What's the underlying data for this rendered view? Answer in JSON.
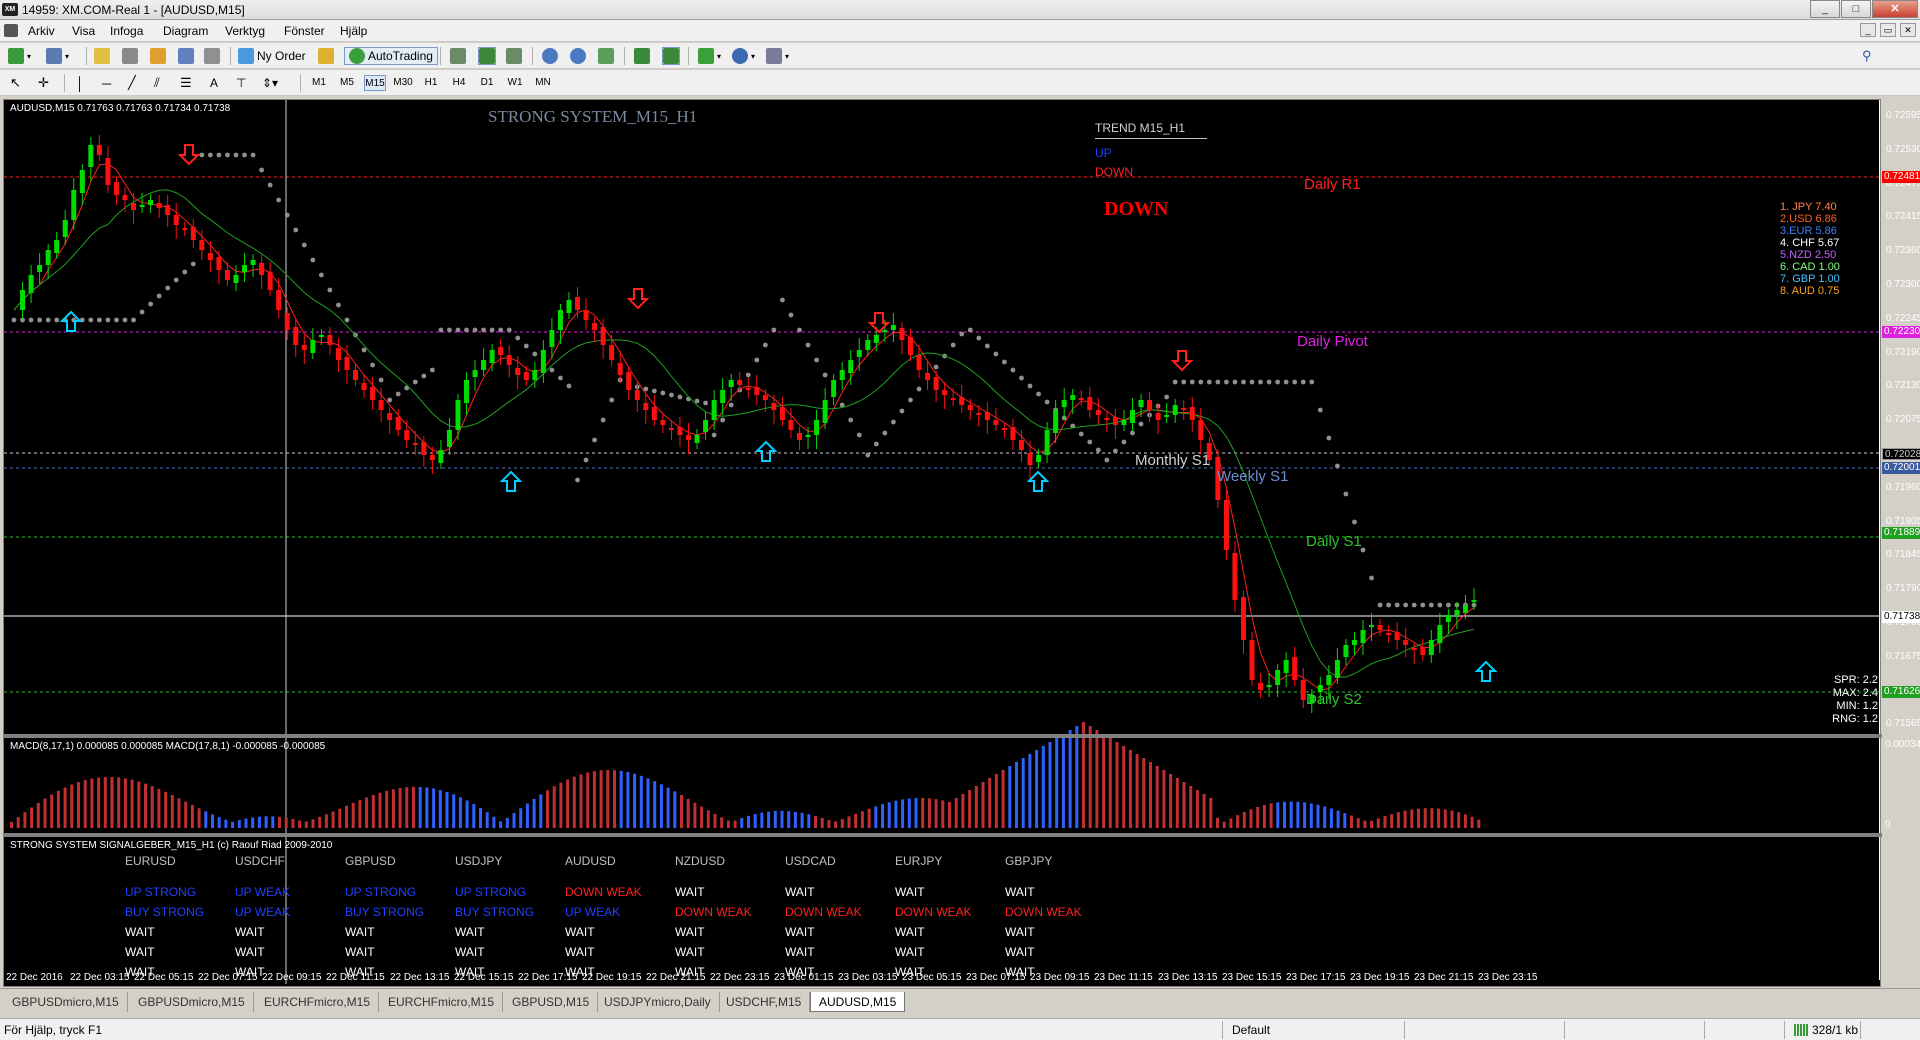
{
  "window": {
    "title": "14959: XM.COM-Real 1 - [AUDUSD,M15]",
    "app_icon_text": "XM",
    "minimize": "_",
    "maximize": "□",
    "close": "✕"
  },
  "menu": {
    "items": [
      "Arkiv",
      "Visa",
      "Infoga",
      "Diagram",
      "Verktyg",
      "Fönster",
      "Hjälp"
    ],
    "mdi_buttons": [
      "_",
      "▭",
      "✕"
    ]
  },
  "toolbar": {
    "new_order": "Ny Order",
    "autotrading": "AutoTrading",
    "timeframes": [
      "M1",
      "M5",
      "M15",
      "M30",
      "H1",
      "H4",
      "D1",
      "W1",
      "MN"
    ],
    "active_timeframe": "M15"
  },
  "chart": {
    "symbol_info": "AUDUSD,M15  0.71763 0.71763 0.71734 0.71738",
    "system_title": "STRONG SYSTEM_M15_H1",
    "trend_panel": {
      "title": "TREND M15_H1",
      "up": "UP",
      "down": "DOWN",
      "current": "DOWN"
    },
    "levels": [
      {
        "name": "Daily R1",
        "price": "0.72481",
        "color": "#ff2020"
      },
      {
        "name": "Daily Pivot",
        "price": "0.72230",
        "color": "#e020e0"
      },
      {
        "name": "Monthly S1",
        "price": "0.72028",
        "color": "#d0d0d0"
      },
      {
        "name": "Weekly S1",
        "price": "0.72001",
        "color": "#6a8ecf"
      },
      {
        "name": "Daily S1",
        "price": "0.71889",
        "color": "#30c030"
      },
      {
        "name": "Daily S2",
        "price": "0.71626",
        "color": "#30c030"
      }
    ],
    "bid_price": "0.71738",
    "price_scale": [
      "0.72595",
      "0.72530",
      "0.72475",
      "0.72415",
      "0.72360",
      "0.72300",
      "0.72245",
      "0.72190",
      "0.72130",
      "0.72075",
      "0.72015",
      "0.71960",
      "0.71905",
      "0.71845",
      "0.71790",
      "0.71730",
      "0.71675",
      "0.71620",
      "0.71565"
    ],
    "currency_strength": [
      {
        "label": "1. JPY",
        "value": "7.40",
        "color": "#ff8040"
      },
      {
        "label": "2.USD",
        "value": "6.86",
        "color": "#ff6020"
      },
      {
        "label": "3.EUR",
        "value": "5.86",
        "color": "#4080ff"
      },
      {
        "label": "4. CHF",
        "value": "5.67",
        "color": "#ffffff"
      },
      {
        "label": "5.NZD",
        "value": "2.50",
        "color": "#c060ff"
      },
      {
        "label": "6. CAD",
        "value": "1.00",
        "color": "#80ff80"
      },
      {
        "label": "7. GBP",
        "value": "1.00",
        "color": "#40c0ff"
      },
      {
        "label": "8. AUD",
        "value": "0.75",
        "color": "#ffa020"
      }
    ],
    "spread_info": [
      "SPR: 2.2",
      "MAX: 2.4",
      "MIN: 1.2",
      "RNG: 1.2"
    ]
  },
  "macd": {
    "label": "MACD(8,17,1) 0.000085 0.000085  MACD(17,8,1) -0.000085 -0.000085",
    "scale_top": "0.000349",
    "scale_zero": "0"
  },
  "signals": {
    "title": "STRONG SYSTEM SIGNALGEBER_M15_H1 (c) Raouf Riad 2009-2010",
    "pairs": [
      {
        "name": "EURUSD",
        "rows": [
          [
            "UP STRONG",
            "#2040ff"
          ],
          [
            "BUY STRONG",
            "#2040ff"
          ],
          [
            "WAIT",
            "#ffffff"
          ],
          [
            "WAIT",
            "#ffffff"
          ],
          [
            "WAIT",
            "#ffffff"
          ]
        ]
      },
      {
        "name": "USDCHF",
        "rows": [
          [
            "UP WEAK",
            "#2040ff"
          ],
          [
            "UP WEAK",
            "#2040ff"
          ],
          [
            "WAIT",
            "#ffffff"
          ],
          [
            "WAIT",
            "#ffffff"
          ],
          [
            "WAIT",
            "#ffffff"
          ]
        ]
      },
      {
        "name": "GBPUSD",
        "rows": [
          [
            "UP STRONG",
            "#2040ff"
          ],
          [
            "BUY STRONG",
            "#2040ff"
          ],
          [
            "WAIT",
            "#ffffff"
          ],
          [
            "WAIT",
            "#ffffff"
          ],
          [
            "WAIT",
            "#ffffff"
          ]
        ]
      },
      {
        "name": "USDJPY",
        "rows": [
          [
            "UP STRONG",
            "#2040ff"
          ],
          [
            "BUY STRONG",
            "#2040ff"
          ],
          [
            "WAIT",
            "#ffffff"
          ],
          [
            "WAIT",
            "#ffffff"
          ],
          [
            "WAIT",
            "#ffffff"
          ]
        ]
      },
      {
        "name": "AUDUSD",
        "rows": [
          [
            "DOWN WEAK",
            "#ff2020"
          ],
          [
            "UP WEAK",
            "#2040ff"
          ],
          [
            "WAIT",
            "#ffffff"
          ],
          [
            "WAIT",
            "#ffffff"
          ],
          [
            "WAIT",
            "#ffffff"
          ]
        ]
      },
      {
        "name": "NZDUSD",
        "rows": [
          [
            "WAIT",
            "#ffffff"
          ],
          [
            "DOWN WEAK",
            "#ff2020"
          ],
          [
            "WAIT",
            "#ffffff"
          ],
          [
            "WAIT",
            "#ffffff"
          ],
          [
            "WAIT",
            "#ffffff"
          ]
        ]
      },
      {
        "name": "USDCAD",
        "rows": [
          [
            "WAIT",
            "#ffffff"
          ],
          [
            "DOWN WEAK",
            "#ff2020"
          ],
          [
            "WAIT",
            "#ffffff"
          ],
          [
            "WAIT",
            "#ffffff"
          ],
          [
            "WAIT",
            "#ffffff"
          ]
        ]
      },
      {
        "name": "EURJPY",
        "rows": [
          [
            "WAIT",
            "#ffffff"
          ],
          [
            "DOWN WEAK",
            "#ff2020"
          ],
          [
            "WAIT",
            "#ffffff"
          ],
          [
            "WAIT",
            "#ffffff"
          ],
          [
            "WAIT",
            "#ffffff"
          ]
        ]
      },
      {
        "name": "GBPJPY",
        "rows": [
          [
            "WAIT",
            "#ffffff"
          ],
          [
            "DOWN WEAK",
            "#ff2020"
          ],
          [
            "WAIT",
            "#ffffff"
          ],
          [
            "WAIT",
            "#ffffff"
          ],
          [
            "WAIT",
            "#ffffff"
          ]
        ]
      }
    ]
  },
  "time_axis": [
    "22 Dec 2016",
    "22 Dec 03:15",
    "22 Dec 05:15",
    "22 Dec 07:15",
    "22 Dec 09:15",
    "22 Dec 11:15",
    "22 Dec 13:15",
    "22 Dec 15:15",
    "22 Dec 17:15",
    "22 Dec 19:15",
    "22 Dec 21:15",
    "22 Dec 23:15",
    "23 Dec 01:15",
    "23 Dec 03:15",
    "23 Dec 05:15",
    "23 Dec 07:15",
    "23 Dec 09:15",
    "23 Dec 11:15",
    "23 Dec 13:15",
    "23 Dec 15:15",
    "23 Dec 17:15",
    "23 Dec 19:15",
    "23 Dec 21:15",
    "23 Dec 23:15"
  ],
  "tabs": [
    "GBPUSDmicro,M15",
    "GBPUSDmicro,M15",
    "EURCHFmicro,M15",
    "EURCHFmicro,M15",
    "GBPUSD,M15",
    "USDJPYmicro,Daily",
    "USDCHF,M15",
    "AUDUSD,M15"
  ],
  "active_tab": "AUDUSD,M15",
  "status": {
    "help": "För Hjälp, tryck F1",
    "profile": "Default",
    "traffic": "328/1 kb"
  },
  "colors": {
    "bull": "#00dd00",
    "bear": "#ff1010",
    "up_arrow": "#00d0ff",
    "down_arrow": "#ff2020",
    "trail_dots": "#909090",
    "ma_fast": "#ff2020",
    "ma_slow": "#20a020",
    "macd_pos": "#3060ff",
    "macd_neg": "#c03030"
  }
}
